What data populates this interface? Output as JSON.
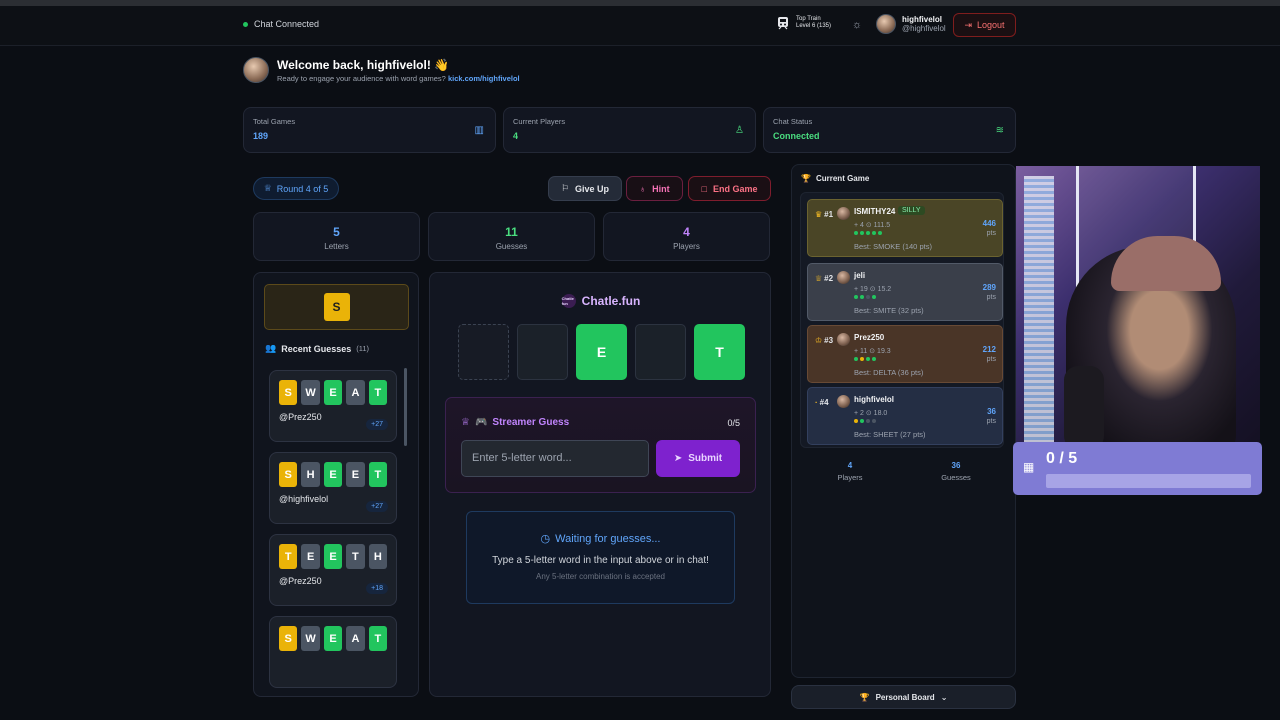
{
  "nav": {
    "chat_status": "Chat Connected",
    "train_title": "Top Train",
    "train_level": "Level 6 (135)",
    "username": "highfivelol",
    "handle": "@highfivelol",
    "logout": "Logout"
  },
  "welcome": {
    "title": "Welcome back, highfivelol! 👋",
    "subtitle": "Ready to engage your audience with word games?",
    "link": "kick.com/highfivelol"
  },
  "stats": [
    {
      "label": "Total Games",
      "value": "189",
      "color": "#60a5fa"
    },
    {
      "label": "Current Players",
      "value": "4",
      "color": "#4ade80"
    },
    {
      "label": "Chat Status",
      "value": "Connected",
      "color": "#4ade80"
    }
  ],
  "game": {
    "round": "Round 4 of 5",
    "give_up": "Give Up",
    "hint": "Hint",
    "end_game": "End Game",
    "letters": "5",
    "letters_label": "Letters",
    "guesses": "11",
    "guesses_label": "Guesses",
    "players": "4",
    "players_label": "Players",
    "hint_letter": "S",
    "recent_title": "Recent Guesses",
    "recent_count": "(11)",
    "brand": "Chatle.fun",
    "brand_logo": "Chatle fun",
    "word_slots": [
      "",
      "",
      "E",
      "",
      "T"
    ],
    "streamer_guess": "Streamer Guess",
    "streamer_count": "0/5",
    "input_placeholder": "Enter 5-letter word...",
    "submit": "Submit",
    "waiting_title": "Waiting for guesses...",
    "waiting_line": "Type a 5-letter word in the input above or in chat!",
    "waiting_note": "Any 5-letter combination is accepted"
  },
  "recent_guesses": [
    {
      "letters": [
        "S",
        "W",
        "E",
        "A",
        "T"
      ],
      "states": [
        "y",
        "x",
        "g",
        "x",
        "g"
      ],
      "user": "@Prez250",
      "points": "+27"
    },
    {
      "letters": [
        "S",
        "H",
        "E",
        "E",
        "T"
      ],
      "states": [
        "y",
        "x",
        "g",
        "x",
        "g"
      ],
      "user": "@highfivelol",
      "points": "+27"
    },
    {
      "letters": [
        "T",
        "E",
        "E",
        "T",
        "H"
      ],
      "states": [
        "y",
        "x",
        "g",
        "x",
        "x"
      ],
      "user": "@Prez250",
      "points": "+18"
    },
    {
      "letters": [
        "S",
        "W",
        "E",
        "A",
        "T"
      ],
      "states": [
        "y",
        "x",
        "g",
        "x",
        "g"
      ],
      "user": "",
      "points": ""
    }
  ],
  "current_game": {
    "title": "Current Game",
    "players": [
      {
        "rank": "#1",
        "name": "ISMITHY24",
        "tag": "SILLY",
        "stats": "+ 4  ⊙ 111.5",
        "best": "Best: SMOKE (140 pts)",
        "score": "446",
        "pts": "pts"
      },
      {
        "rank": "#2",
        "name": "jeli",
        "tag": "",
        "stats": "+ 19  ⊙ 15.2",
        "best": "Best: SMITE (32 pts)",
        "score": "289",
        "pts": "pts"
      },
      {
        "rank": "#3",
        "name": "Prez250",
        "tag": "",
        "stats": "+ 11  ⊙ 19.3",
        "best": "Best: DELTA (36 pts)",
        "score": "212",
        "pts": "pts"
      },
      {
        "rank": "#4",
        "name": "highfivelol",
        "tag": "",
        "stats": "+ 2  ⊙ 18.0",
        "best": "Best: SHEET (27 pts)",
        "score": "36",
        "pts": "pts"
      }
    ],
    "footer_players": "4",
    "footer_players_label": "Players",
    "footer_guesses": "36",
    "footer_guesses_label": "Guesses",
    "personal_board": "Personal Board"
  },
  "overlay": {
    "goal_text": "0 / 5",
    "goal_progress": 0
  }
}
